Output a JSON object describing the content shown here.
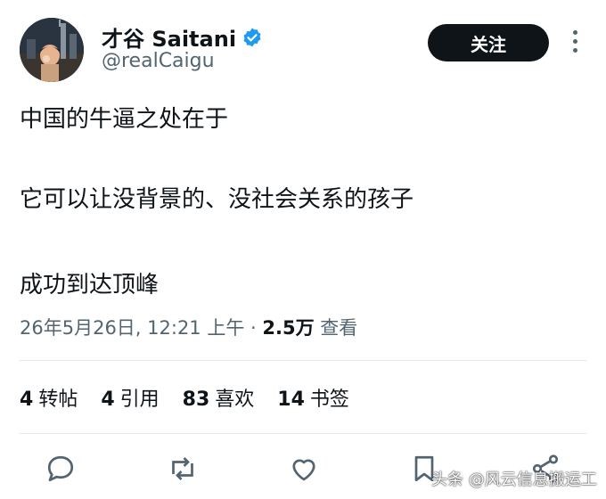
{
  "author": {
    "display_name": "才谷 Saitani",
    "handle": "@realCaigu"
  },
  "follow_button": {
    "label": "关注"
  },
  "tweet": {
    "lines": [
      "中国的牛逼之处在于",
      "它可以让没背景的、没社会关系的孩子",
      "成功到达顶峰"
    ]
  },
  "meta": {
    "timestamp": "26年5月26日, 12:21 上午",
    "separator": " · ",
    "views_count": "2.5万",
    "views_label": " 查看"
  },
  "stats": {
    "reposts_count": "4",
    "reposts_label": "转帖",
    "quotes_count": "4",
    "quotes_label": "引用",
    "likes_count": "83",
    "likes_label": "喜欢",
    "bookmarks_count": "14",
    "bookmarks_label": "书签"
  },
  "actions": [
    "reply-icon",
    "repost-icon",
    "like-icon",
    "bookmark-icon",
    "share-icon"
  ],
  "watermark": "头条 @风云信息搬运工",
  "colors": {
    "verified": "#1d9bf0",
    "follow_bg": "#0f1419",
    "secondary_text": "#536471"
  }
}
